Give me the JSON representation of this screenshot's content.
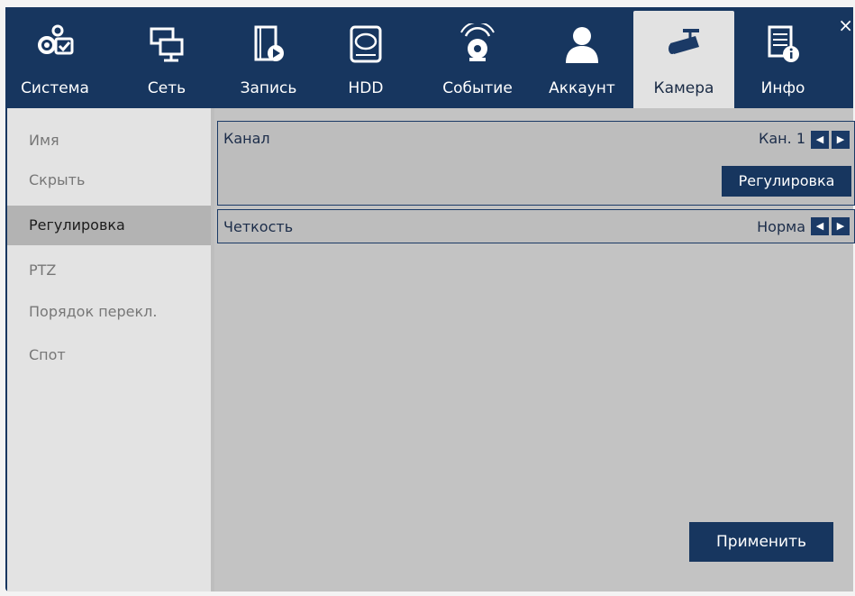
{
  "tabs": [
    {
      "label": "Система",
      "icon": "settings-icon"
    },
    {
      "label": "Сеть",
      "icon": "network-icon"
    },
    {
      "label": "Запись",
      "icon": "record-icon"
    },
    {
      "label": "HDD",
      "icon": "hdd-icon"
    },
    {
      "label": "Событие",
      "icon": "alarm-icon"
    },
    {
      "label": "Аккаунт",
      "icon": "user-icon"
    },
    {
      "label": "Камера",
      "icon": "camera-icon",
      "active": true
    },
    {
      "label": "Инфо",
      "icon": "info-icon"
    }
  ],
  "close_glyph": "×",
  "sidebar": {
    "items": [
      {
        "label": "Имя"
      },
      {
        "label": "Скрыть"
      },
      {
        "label": "Регулировка",
        "active": true
      },
      {
        "label": "PTZ"
      },
      {
        "label": "Порядок перекл."
      },
      {
        "label": "Спот"
      }
    ]
  },
  "main": {
    "channel": {
      "label": "Канал",
      "value": "Кан. 1",
      "adjust_button": "Регулировка"
    },
    "clarity": {
      "label": "Четкость",
      "value": "Норма"
    },
    "apply_button": "Применить"
  },
  "colors": {
    "navy": "#17365f",
    "active_tab": "#e2e2e2",
    "sidebar": "#e3e3e3",
    "panel": "#c3c3c3"
  }
}
